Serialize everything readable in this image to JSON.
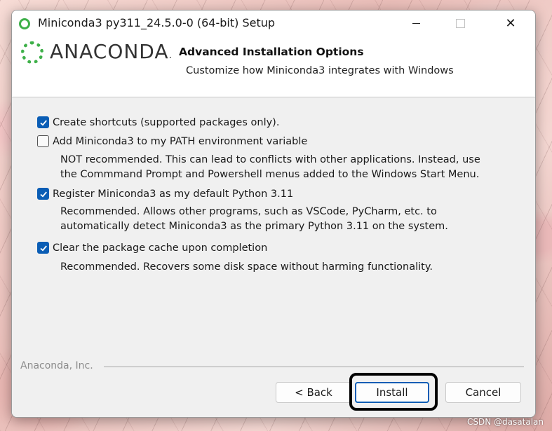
{
  "window": {
    "title": "Miniconda3 py311_24.5.0-0 (64-bit) Setup",
    "close_glyph": "✕"
  },
  "header": {
    "logo_text": "ANACONDA",
    "logo_dot": ".",
    "title": "Advanced Installation Options",
    "subtitle": "Customize how Miniconda3 integrates with Windows"
  },
  "options": [
    {
      "label": "Create shortcuts (supported packages only).",
      "checked": true,
      "description": []
    },
    {
      "label": "Add Miniconda3 to my PATH environment variable",
      "checked": false,
      "description": [
        "NOT recommended. This can lead to conflicts with other applications. Instead, use",
        "the Commmand Prompt and Powershell menus added to the Windows Start Menu."
      ]
    },
    {
      "label": "Register Miniconda3 as my default Python 3.11",
      "checked": true,
      "description": [
        "Recommended. Allows other programs, such as VSCode, PyCharm, etc. to",
        "automatically detect Miniconda3 as the primary Python 3.11 on the system."
      ]
    },
    {
      "label": "Clear the package cache upon completion",
      "checked": true,
      "description": [
        "Recommended. Recovers some disk space without harming functionality."
      ]
    }
  ],
  "footer": {
    "brand": "Anaconda, Inc.",
    "back_label": "< Back",
    "install_label": "Install",
    "cancel_label": "Cancel"
  },
  "watermark": "CSDN @dasatalan",
  "colors": {
    "accent": "#0a5db5",
    "brand_green": "#3eb049"
  }
}
